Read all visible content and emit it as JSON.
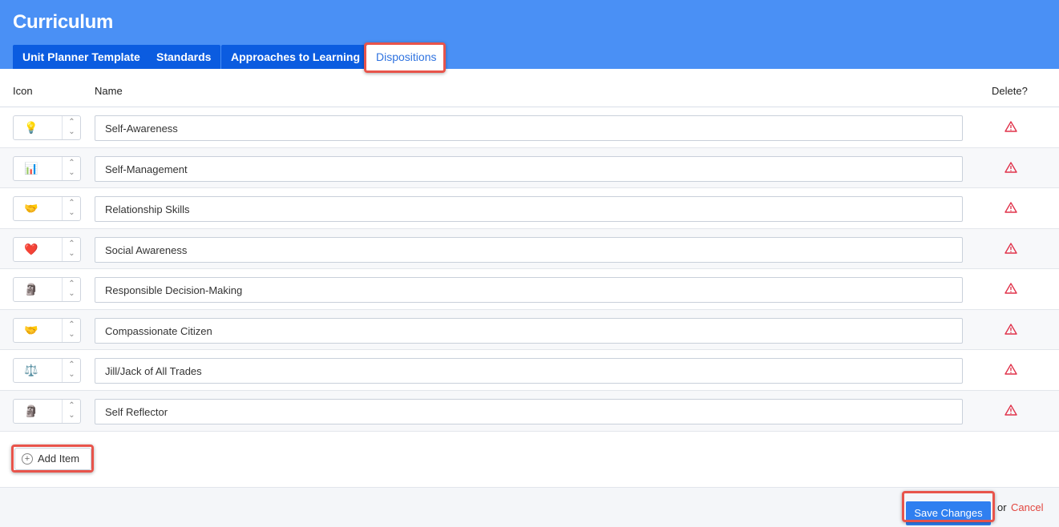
{
  "header": {
    "title": "Curriculum",
    "tabs": [
      {
        "label": "Unit Planner Template"
      },
      {
        "label": "Standards"
      },
      {
        "label": "Approaches to Learning"
      },
      {
        "label": "Dispositions",
        "active": true
      }
    ]
  },
  "table": {
    "columns": {
      "icon": "Icon",
      "name": "Name",
      "delete": "Delete?"
    },
    "rows": [
      {
        "icon": "💡",
        "icon_name": "light-bulb-icon",
        "name": "Self-Awareness"
      },
      {
        "icon": "📊",
        "icon_name": "bar-chart-icon",
        "name": "Self-Management"
      },
      {
        "icon": "🤝",
        "icon_name": "handshake-icon",
        "name": "Relationship Skills"
      },
      {
        "icon": "❤️",
        "icon_name": "heart-icon",
        "name": "Social Awareness"
      },
      {
        "icon": "🗿",
        "icon_name": "thinker-icon",
        "name": "Responsible Decision-Making"
      },
      {
        "icon": "🤝",
        "icon_name": "handshake-icon",
        "name": "Compassionate Citizen"
      },
      {
        "icon": "⚖️",
        "icon_name": "scales-icon",
        "name": "Jill/Jack of All Trades"
      },
      {
        "icon": "🗿",
        "icon_name": "thinker-icon",
        "name": "Self Reflector"
      }
    ]
  },
  "actions": {
    "add_item": "Add Item",
    "save": "Save Changes",
    "or": "or",
    "cancel": "Cancel"
  },
  "colors": {
    "header_bg": "#4a90f5",
    "tab_bg": "#0b5ce0",
    "highlight": "#e8544b",
    "delete_icon": "#e0324a",
    "cancel": "#e2463f",
    "save_bg": "#2f7ff0"
  }
}
